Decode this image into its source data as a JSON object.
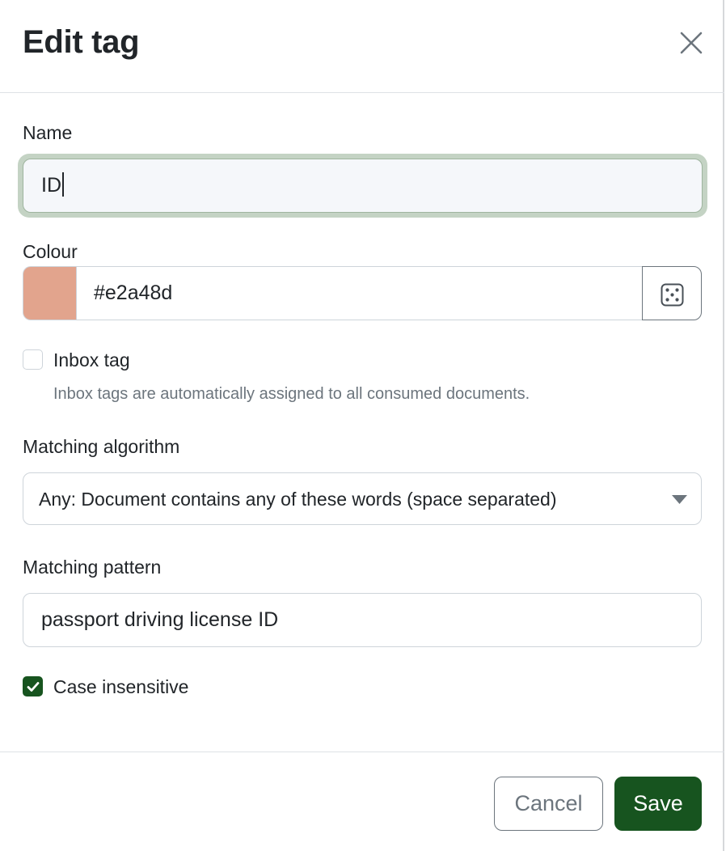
{
  "modal": {
    "title": "Edit tag",
    "close_icon": "close-icon"
  },
  "name_field": {
    "label": "Name",
    "value": "ID"
  },
  "colour_field": {
    "label": "Colour",
    "value": "#e2a48d",
    "swatch_color": "#e2a48d",
    "random_icon": "dice-icon"
  },
  "inbox_tag": {
    "label": "Inbox tag",
    "checked": false,
    "help": "Inbox tags are automatically assigned to all consumed documents."
  },
  "matching_algorithm": {
    "label": "Matching algorithm",
    "selected": "Any: Document contains any of these words (space separated)",
    "arrow_icon": "caret-down-icon"
  },
  "matching_pattern": {
    "label": "Matching pattern",
    "value": "passport driving license ID"
  },
  "case_insensitive": {
    "label": "Case insensitive",
    "checked": true
  },
  "footer": {
    "cancel_label": "Cancel",
    "save_label": "Save"
  },
  "colors": {
    "primary": "#17541f",
    "focus_ring": "#c4d3c4",
    "muted": "#6c757d"
  }
}
